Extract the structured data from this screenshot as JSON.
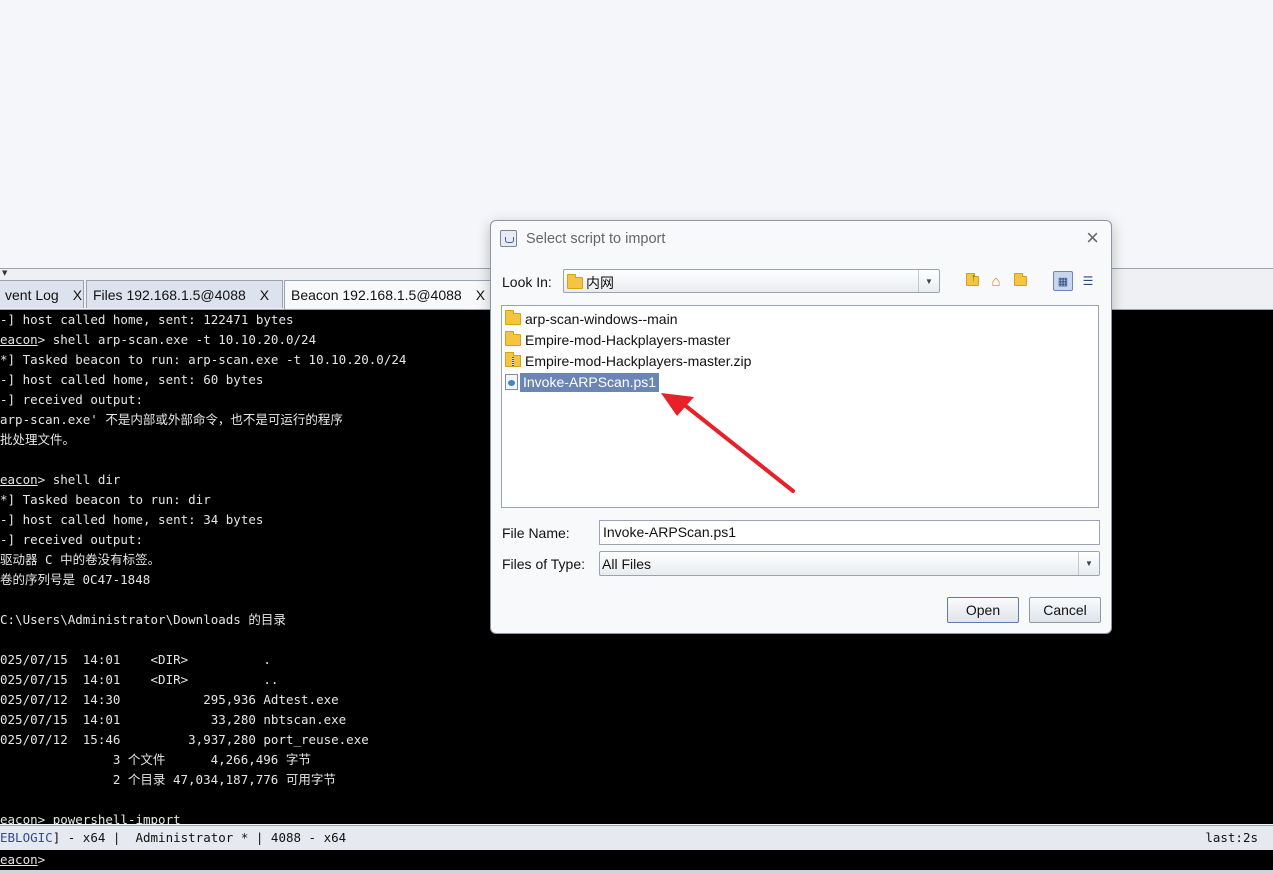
{
  "tabs": [
    {
      "label": "vent Log",
      "close": "X"
    },
    {
      "label": "Files 192.168.1.5@4088",
      "close": "X"
    },
    {
      "label": "Beacon 192.168.1.5@4088",
      "close": "X"
    }
  ],
  "console": {
    "lines": [
      {
        "prefix": "-]",
        "text": " host called home, sent: 122471 bytes"
      },
      {
        "prefix": "eacon",
        "text": "> shell arp-scan.exe -t 10.10.20.0/24"
      },
      {
        "prefix": "*]",
        "text": " Tasked beacon to run: arp-scan.exe -t 10.10.20.0/24"
      },
      {
        "prefix": "-]",
        "text": " host called home, sent: 60 bytes"
      },
      {
        "prefix": "-]",
        "text": " received output:"
      },
      {
        "prefix": "",
        "text": "arp-scan.exe' 不是内部或外部命令，也不是可运行的程序"
      },
      {
        "prefix": "",
        "text": "批处理文件。"
      },
      {
        "prefix": "",
        "text": ""
      },
      {
        "prefix": "eacon",
        "text": "> shell dir"
      },
      {
        "prefix": "*]",
        "text": " Tasked beacon to run: dir"
      },
      {
        "prefix": "-]",
        "text": " host called home, sent: 34 bytes"
      },
      {
        "prefix": "-]",
        "text": " received output:"
      },
      {
        "prefix": "",
        "text": "驱动器 C 中的卷没有标签。"
      },
      {
        "prefix": "",
        "text": "卷的序列号是 0C47-1848"
      },
      {
        "prefix": "",
        "text": ""
      },
      {
        "prefix": "",
        "text": "C:\\Users\\Administrator\\Downloads 的目录"
      },
      {
        "prefix": "",
        "text": ""
      },
      {
        "prefix": "",
        "text": "025/07/15  14:01    <DIR>          ."
      },
      {
        "prefix": "",
        "text": "025/07/15  14:01    <DIR>          .."
      },
      {
        "prefix": "",
        "text": "025/07/12  14:30           295,936 Adtest.exe"
      },
      {
        "prefix": "",
        "text": "025/07/15  14:01            33,280 nbtscan.exe"
      },
      {
        "prefix": "",
        "text": "025/07/12  15:46         3,937,280 port_reuse.exe"
      },
      {
        "prefix": "",
        "text": "               3 个文件      4,266,496 字节"
      },
      {
        "prefix": "",
        "text": "               2 个目录 47,034,187,776 可用字节"
      },
      {
        "prefix": "",
        "text": ""
      },
      {
        "prefix": "eacon",
        "text": "> powershell-import"
      }
    ]
  },
  "statusbar": {
    "host": "EBLOGIC",
    "rest": "] - x64 |  Administrator * | 4088 - x64",
    "last": "last:2s"
  },
  "prompt": {
    "prefix": "eacon",
    "suffix": ">"
  },
  "dialog": {
    "title": "Select script to import",
    "close": "×",
    "look_in_label": "Look In:",
    "look_in_value": "内网",
    "toolbar_icons": [
      "up-folder-icon",
      "home-icon",
      "new-folder-icon",
      "list-view-icon",
      "details-view-icon"
    ],
    "files": [
      {
        "name": "arp-scan-windows--main",
        "type": "folder"
      },
      {
        "name": "Empire-mod-Hackplayers-master",
        "type": "folder"
      },
      {
        "name": "Empire-mod-Hackplayers-master.zip",
        "type": "zip"
      },
      {
        "name": "Invoke-ARPScan.ps1",
        "type": "ps1",
        "selected": true
      }
    ],
    "file_name_label": "File Name:",
    "file_name_value": "Invoke-ARPScan.ps1",
    "file_type_label": "Files of Type:",
    "file_type_value": "All Files",
    "open_button": "Open",
    "cancel_button": "Cancel"
  },
  "annotation": {
    "color": "#e8202a"
  }
}
